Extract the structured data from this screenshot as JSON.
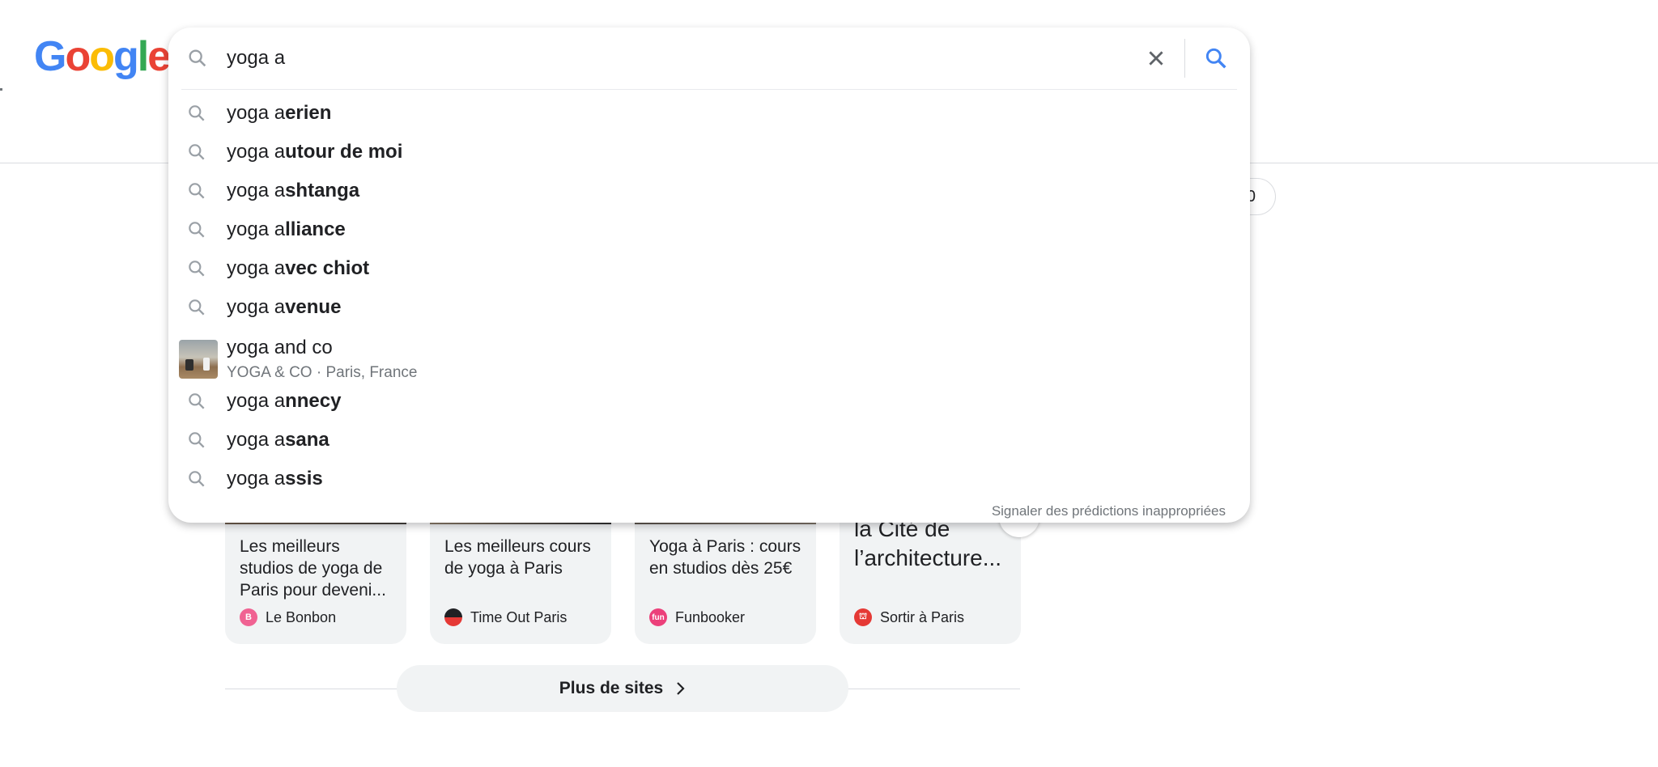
{
  "logo": {
    "letters": [
      "G",
      "o",
      "o",
      "g",
      "l",
      "e"
    ],
    "colors": [
      "#4285F4",
      "#EA4335",
      "#FBBC05",
      "#4285F4",
      "#34A853",
      "#EA4335"
    ]
  },
  "search": {
    "query": "yoga a",
    "typed_prefix": "yoga a"
  },
  "suggestions": [
    {
      "prefix": "yoga a",
      "completion": "erien"
    },
    {
      "prefix": "yoga a",
      "completion": "utour de moi"
    },
    {
      "prefix": "yoga a",
      "completion": "shtanga"
    },
    {
      "prefix": "yoga a",
      "completion": "lliance"
    },
    {
      "prefix": "yoga a",
      "completion": "vec chiot"
    },
    {
      "prefix": "yoga a",
      "completion": "venue"
    }
  ],
  "rich_suggestion": {
    "title": "yoga and co",
    "subtitle": "YOGA & CO · Paris, France"
  },
  "suggestions_after": [
    {
      "prefix": "yoga a",
      "completion": "nnecy"
    },
    {
      "prefix": "yoga a",
      "completion": "sana"
    },
    {
      "prefix": "yoga a",
      "completion": "ssis"
    }
  ],
  "report_link": "Signaler des prédictions inappropriées",
  "chip_partial_text": "0",
  "cards": [
    {
      "title": "Les meilleurs studios de yoga de Paris pour deveni...",
      "source": "Le Bonbon",
      "favicon_color": "#f06292",
      "favicon_text": "B"
    },
    {
      "title": "Les meilleurs cours de yoga à Paris",
      "source": "Time Out Paris",
      "favicon_color": "#202124",
      "favicon_text": ""
    },
    {
      "title": "Yoga à Paris : cours en studios dès 25€",
      "source": "Funbooker",
      "favicon_color": "#ec407a",
      "favicon_text": "fun"
    },
    {
      "title": "la Cité de l’architecture...",
      "source": "Sortir à Paris",
      "favicon_color": "#e53935",
      "favicon_text": "⛫"
    }
  ],
  "more_sites": {
    "label": "Plus de sites"
  }
}
